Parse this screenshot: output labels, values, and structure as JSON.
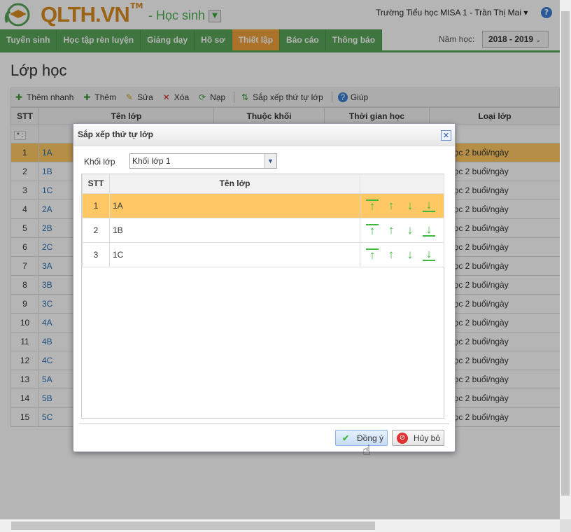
{
  "header": {
    "logo": "QLTH.VN",
    "tm": "TM",
    "role": "- Học sinh",
    "school_user": "Trường Tiểu học MISA 1 - Trần Thị Mai ▾",
    "help": "?"
  },
  "nav": {
    "items": [
      "Tuyển sinh",
      "Học tập rèn luyện",
      "Giảng dạy",
      "Hồ sơ",
      "Thiết lập",
      "Báo cáo",
      "Thông báo"
    ],
    "active": 4,
    "year_label": "Năm học:",
    "year_value": "2018 - 2019"
  },
  "page": {
    "title": "Lớp học"
  },
  "toolbar": {
    "quick_add": "Thêm nhanh",
    "add": "Thêm",
    "edit": "Sửa",
    "delete": "Xóa",
    "reload": "Nạp",
    "sort": "Sắp xếp thứ tự lớp",
    "help": "Giúp"
  },
  "grid": {
    "columns": [
      "STT",
      "Tên lớp",
      "Thuộc khối",
      "Thời gian học",
      "Loại lớp"
    ],
    "filter_op": "* :",
    "rows": [
      [
        "1",
        "1A"
      ],
      [
        "2",
        "1B"
      ],
      [
        "3",
        "1C"
      ],
      [
        "4",
        "2A"
      ],
      [
        "5",
        "2B"
      ],
      [
        "6",
        "2C"
      ],
      [
        "7",
        "3A"
      ],
      [
        "8",
        "3B"
      ],
      [
        "9",
        "3C"
      ],
      [
        "10",
        "4A"
      ],
      [
        "11",
        "4B"
      ],
      [
        "12",
        "4C"
      ],
      [
        "13",
        "5A"
      ],
      [
        "14",
        "5B"
      ],
      [
        "15",
        "5C"
      ]
    ],
    "type_value": "Học 2 buổi/ngày"
  },
  "dialog": {
    "title": "Sắp xếp thứ tự lớp",
    "grade_label": "Khối lớp",
    "grade_value": "Khối lớp 1",
    "columns": [
      "STT",
      "Tên lớp",
      ""
    ],
    "rows": [
      [
        "1",
        "1A"
      ],
      [
        "2",
        "1B"
      ],
      [
        "3",
        "1C"
      ]
    ],
    "ok": "Đồng ý",
    "cancel": "Hủy bỏ"
  },
  "colors": {
    "green": "#5aa55a",
    "orange": "#f0a33a",
    "selected_row": "#ffc864"
  }
}
